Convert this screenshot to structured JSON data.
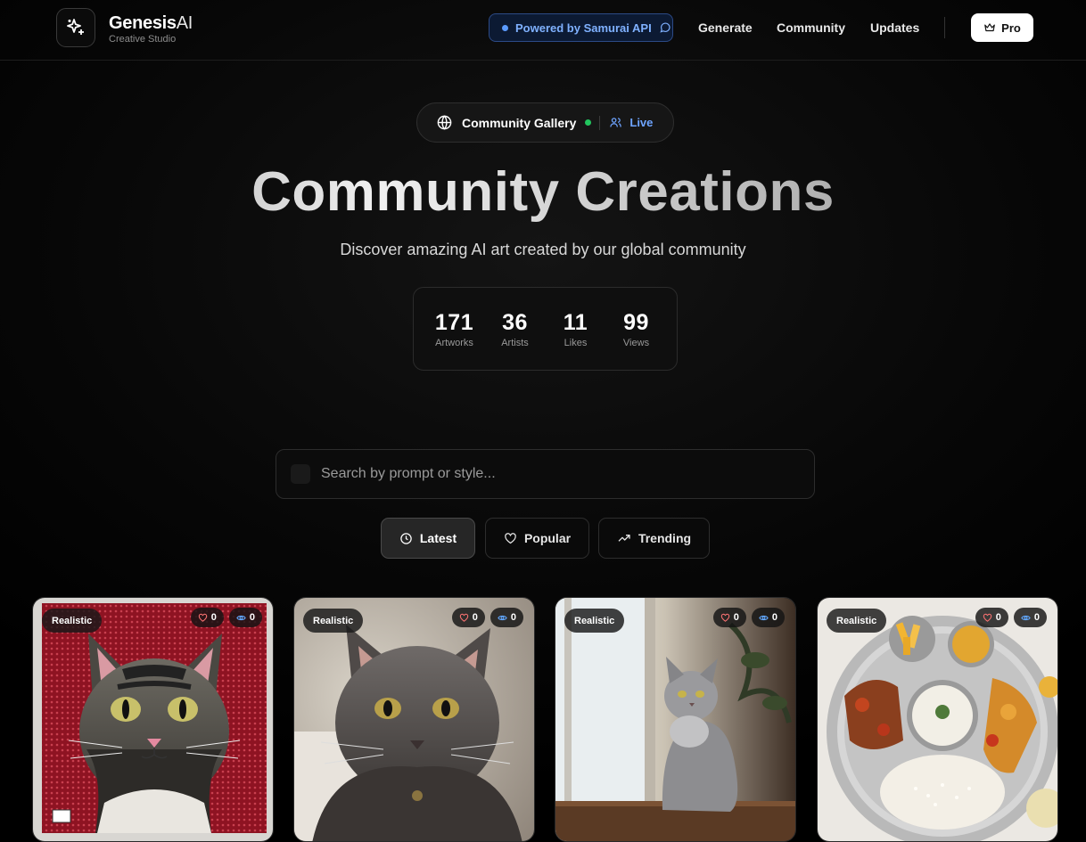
{
  "brand": {
    "name": "Genesis",
    "name_suffix": "AI",
    "tagline": "Creative Studio"
  },
  "nav": {
    "powered": "Powered by Samurai API",
    "links": [
      "Generate",
      "Community",
      "Updates"
    ],
    "pro": "Pro"
  },
  "hero": {
    "pill_label": "Community Gallery",
    "pill_live": "Live",
    "title": "Community Creations",
    "subtitle": "Discover amazing AI art created by our global community"
  },
  "stats": [
    {
      "value": "171",
      "label": "Artworks"
    },
    {
      "value": "36",
      "label": "Artists"
    },
    {
      "value": "11",
      "label": "Likes"
    },
    {
      "value": "99",
      "label": "Views"
    }
  ],
  "search": {
    "placeholder": "Search by prompt or style..."
  },
  "filters": [
    {
      "label": "Latest",
      "active": true
    },
    {
      "label": "Popular",
      "active": false
    },
    {
      "label": "Trending",
      "active": false
    }
  ],
  "cards": [
    {
      "tag": "Realistic",
      "likes": "0",
      "views": "0",
      "subject": "tabby cat on red sequin background"
    },
    {
      "tag": "Realistic",
      "likes": "0",
      "views": "0",
      "subject": "grey long-haired cat"
    },
    {
      "tag": "Realistic",
      "likes": "0",
      "views": "0",
      "subject": "grey cat by window"
    },
    {
      "tag": "Realistic",
      "likes": "0",
      "views": "0",
      "subject": "thali platter with curries and rice"
    }
  ],
  "colors": {
    "accent_blue": "#6ea4ff",
    "live_green": "#22c55e"
  }
}
